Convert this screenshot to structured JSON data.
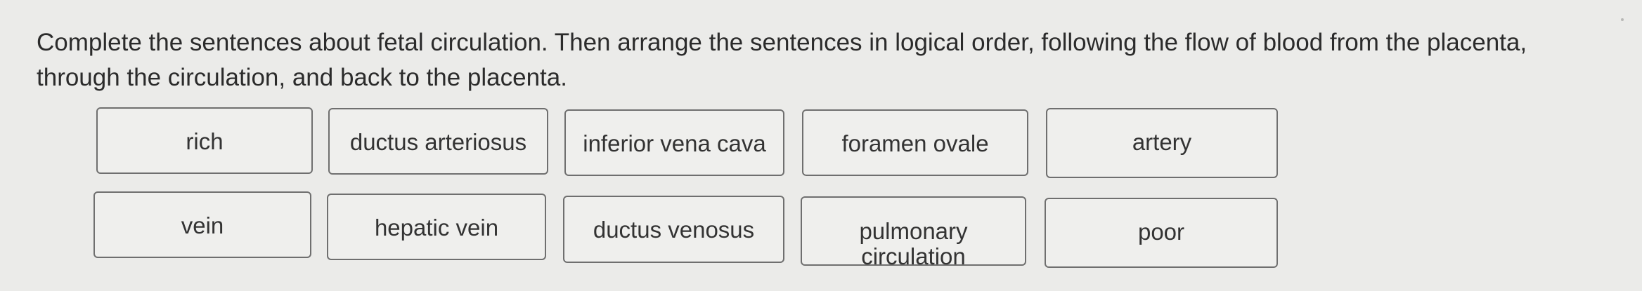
{
  "question": {
    "instructions": "Complete the sentences about fetal circulation. Then arrange the sentences in logical order, following the flow of blood from the placenta, through the circulation, and back to the placenta."
  },
  "word_bank": {
    "row1": [
      "rich",
      "ductus arteriosus",
      "inferior vena cava",
      "foramen ovale",
      "artery"
    ],
    "row2": [
      "vein",
      "hepatic vein",
      "ductus venosus",
      "pulmonary circulation",
      "poor"
    ]
  }
}
